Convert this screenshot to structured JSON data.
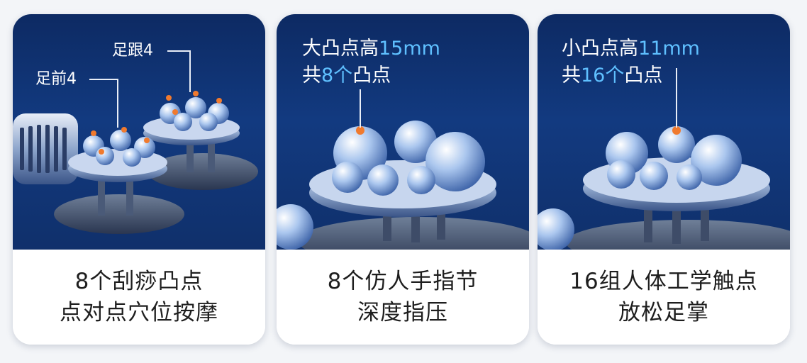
{
  "card1": {
    "label_heel": "足跟4",
    "label_forefoot": "足前4",
    "caption_line1": "8个刮痧凸点",
    "caption_line2": "点对点穴位按摩"
  },
  "card2": {
    "spec1_a": "大凸点高",
    "spec1_b": "15mm",
    "spec2_a": "共",
    "spec2_b": "8个",
    "spec2_c": "凸点",
    "caption_line1": "8个仿人手指节",
    "caption_line2": "深度指压"
  },
  "card3": {
    "spec1_a": "小凸点高",
    "spec1_b": "11mm",
    "spec2_a": "共",
    "spec2_b": "16个",
    "spec2_c": "凸点",
    "caption_line1": "16组人体工学触点",
    "caption_line2": "放松足掌"
  },
  "colors": {
    "photo_bg": "#123a80",
    "highlight": "#5fc0ff",
    "dot": "#f07a2e"
  }
}
